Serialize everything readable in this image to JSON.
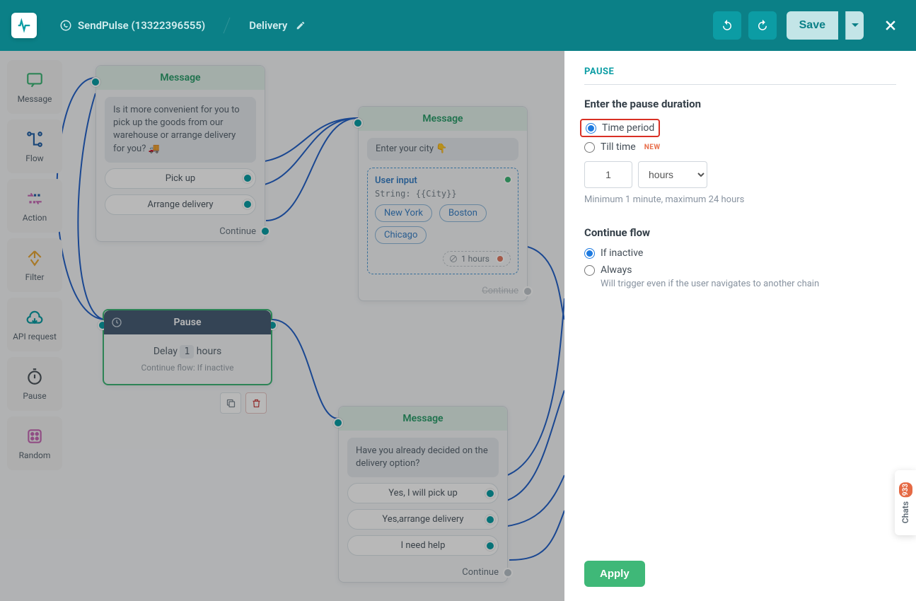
{
  "header": {
    "account": "SendPulse (13322396555)",
    "flow_name": "Delivery",
    "save": "Save"
  },
  "toolbar": [
    {
      "label": "Message"
    },
    {
      "label": "Flow"
    },
    {
      "label": "Action"
    },
    {
      "label": "Filter"
    },
    {
      "label": "API request"
    },
    {
      "label": "Pause"
    },
    {
      "label": "Random"
    }
  ],
  "nodes": {
    "msg1": {
      "title": "Message",
      "text": "Is it more convenient for you to pick up the goods from our warehouse or arrange delivery for you? 🚚",
      "opts": [
        "Pick up",
        "Arrange delivery"
      ],
      "continue": "Continue"
    },
    "msg2": {
      "title": "Message",
      "prompt": "Enter your city 👇",
      "ui_title": "User input",
      "ui_sub": "String: {{City}}",
      "chips": [
        "New York",
        "Boston",
        "Chicago"
      ],
      "pause_tag": "1 hours",
      "continue": "Continue"
    },
    "pause": {
      "title": "Pause",
      "prefix": "Delay",
      "value": "1",
      "unit": "hours",
      "sub": "Continue flow: If inactive"
    },
    "msg3": {
      "title": "Message",
      "text": "Have you already decided on the delivery option?",
      "opts": [
        "Yes, I will pick up",
        "Yes,arrange delivery",
        "I need help"
      ],
      "continue": "Continue"
    }
  },
  "panel": {
    "title": "PAUSE",
    "duration_label": "Enter the pause duration",
    "radio_time_period": "Time period",
    "radio_till_time": "Till time",
    "new_badge": "NEW",
    "value": "1",
    "unit": "hours",
    "hint": "Minimum 1 minute, maximum 24 hours",
    "continue_label": "Continue flow",
    "radio_if_inactive": "If inactive",
    "radio_always": "Always",
    "always_hint": "Will trigger even if the user navigates to another chain",
    "apply": "Apply"
  },
  "chats": {
    "label": "Chats",
    "count": "933"
  }
}
